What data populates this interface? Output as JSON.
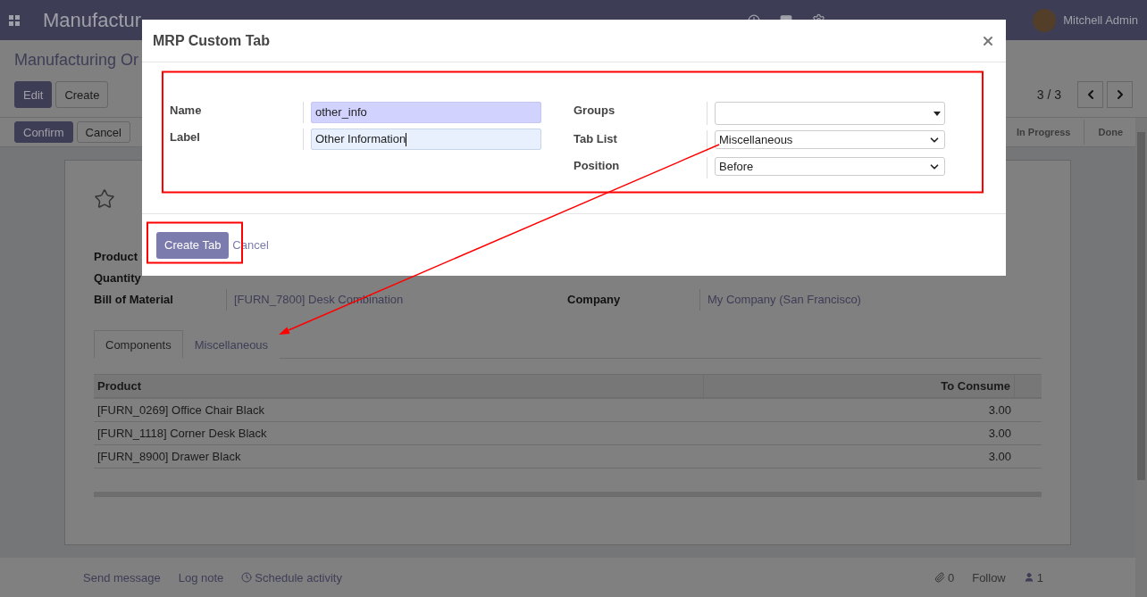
{
  "navbar": {
    "app": "Manufactur",
    "user": "Mitchell Admin"
  },
  "breadcrumb": "Manufacturing Or",
  "control_buttons": [
    {
      "label": "Edit",
      "kind": "primary"
    },
    {
      "label": "Create",
      "kind": "secondary"
    }
  ],
  "pager": "3 / 3",
  "action_buttons": [
    {
      "label": "Confirm",
      "kind": "primary"
    },
    {
      "label": "Cancel",
      "kind": "secondary"
    }
  ],
  "stages": [
    {
      "label": "In Progress",
      "selected": false
    },
    {
      "label": "Done",
      "selected": false
    }
  ],
  "record": {
    "fields": [
      {
        "label": "Product"
      },
      {
        "label": "Quantity"
      },
      {
        "label": "Bill of Material",
        "value": "[FURN_7800] Desk Combination"
      }
    ],
    "company": {
      "label": "Company",
      "value": "My Company (San Francisco)"
    }
  },
  "tabs": [
    {
      "label": "Components",
      "selected": true
    },
    {
      "label": "Miscellaneous",
      "selected": false
    }
  ],
  "table": {
    "columns": [
      "Product",
      "To Consume"
    ],
    "rows": [
      [
        "[FURN_0269] Office Chair Black",
        "3.00"
      ],
      [
        "[FURN_1118] Corner Desk Black",
        "3.00"
      ],
      [
        "[FURN_8900] Drawer Black",
        "3.00"
      ]
    ]
  },
  "chatter": {
    "send": "Send message",
    "log": "Log note",
    "schedule": "Schedule activity",
    "attachments": "0",
    "follow": "Follow",
    "followers": "1"
  },
  "dialog": {
    "title": "MRP Custom Tab",
    "left_fields": [
      {
        "label": "Name",
        "kind": "text",
        "value": "other_info",
        "focused": false
      },
      {
        "label": "Label",
        "kind": "text",
        "value": "Other Information",
        "focused": true
      }
    ],
    "right_fields": [
      {
        "label": "Groups",
        "kind": "many2one"
      },
      {
        "label": "Tab List",
        "kind": "select",
        "value": "Miscellaneous"
      },
      {
        "label": "Position",
        "kind": "select",
        "value": "Before"
      }
    ],
    "primary": "Create Tab",
    "secondary": "Cancel"
  }
}
